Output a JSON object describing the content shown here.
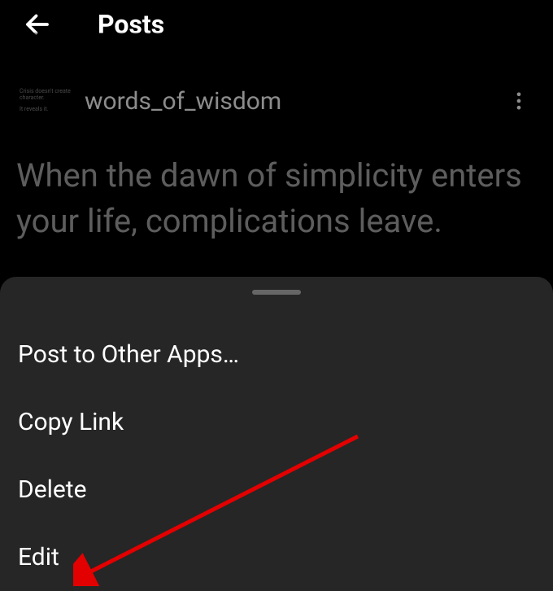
{
  "header": {
    "title": "Posts"
  },
  "post": {
    "avatar_text_line1": "Crisis doesn't create",
    "avatar_text_line2": "character.",
    "avatar_text_line3": "It reveals it.",
    "username": "words_of_wisdom",
    "content": "When the dawn of simplicity enters your life, complications leave."
  },
  "action_sheet": {
    "items": [
      {
        "label": "Post to Other Apps…"
      },
      {
        "label": "Copy Link"
      },
      {
        "label": "Delete"
      },
      {
        "label": "Edit"
      }
    ]
  }
}
